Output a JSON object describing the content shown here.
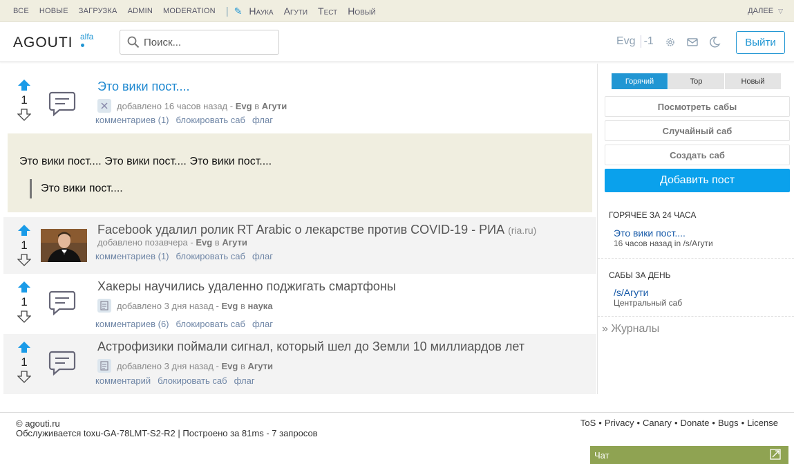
{
  "topbar": {
    "nav": [
      "Все",
      "Новые",
      "Загрузка",
      "Admin",
      "Moderation"
    ],
    "nav2": [
      "Наука",
      "Агути",
      "Тест",
      "Новый"
    ],
    "more": "Далее"
  },
  "header": {
    "logo": "AGOUTI",
    "logo_sub": "alfa",
    "search_placeholder": "Поиск...",
    "username": "Evg",
    "karma": "-1",
    "logout": "Выйти"
  },
  "posts": [
    {
      "votes": "1",
      "title": "Это вики пост....",
      "meta_prefix": "добавлено 16 часов назад -",
      "author": "Evg",
      "in": "в",
      "sub": "Агути",
      "actions": [
        "комментариев (1)",
        "блокировать саб",
        "флаг"
      ]
    },
    {
      "votes": "1",
      "title": "Facebook удалил ролик RT Arabic о лекарстве против COVID-19 - РИА",
      "domain": "(ria.ru)",
      "meta_prefix": "добавлено позавчера -",
      "author": "Evg",
      "in": "в",
      "sub": "Агути",
      "actions": [
        "комментариев (1)",
        "блокировать саб",
        "флаг"
      ]
    },
    {
      "votes": "1",
      "title": "Хакеры научились удаленно поджигать смартфоны",
      "meta_prefix": "добавлено 3 дня назад -",
      "author": "Evg",
      "in": "в",
      "sub": "наука",
      "actions": [
        "комментариев (6)",
        "блокировать саб",
        "флаг"
      ]
    },
    {
      "votes": "1",
      "title": "Астрофизики поймали сигнал, который шел до Земли 10 миллиардов лет",
      "meta_prefix": "добавлено 3 дня назад -",
      "author": "Evg",
      "in": "в",
      "sub": "Агути",
      "actions": [
        "комментарий",
        "блокировать саб",
        "флаг"
      ]
    }
  ],
  "wiki": {
    "text": "Это вики пост.... Это вики пост.... Это вики пост....",
    "quote": "Это вики пост...."
  },
  "sidebar": {
    "tabs": [
      "Горячий",
      "Top",
      "Новый"
    ],
    "view_subs": "Посмотреть сабы",
    "random_sub": "Случайный саб",
    "create_sub": "Создать саб",
    "add_post": "Добавить пост",
    "hot_head": "Горячее за 24 часа",
    "hot_link": "Это вики пост....",
    "hot_sub": "16 часов назад in /s/Агути",
    "subs_head": "Сабы за день",
    "sub_link": "/s/Агути",
    "sub_desc": "Центральный саб",
    "journals": "» Журналы"
  },
  "footer": {
    "site": "© agouti.ru",
    "served": "Обслуживается toxu-GA-78LMT-S2-R2 | Построено за 81ms - 7 запросов",
    "links": [
      "ToS",
      "Privacy",
      "Canary",
      "Donate",
      "Bugs",
      "License"
    ],
    "chat": "Чат"
  },
  "colors": {
    "accent": "#2196d3",
    "topbar_bg": "#f0eee0",
    "chat_bg": "#8fa352"
  }
}
